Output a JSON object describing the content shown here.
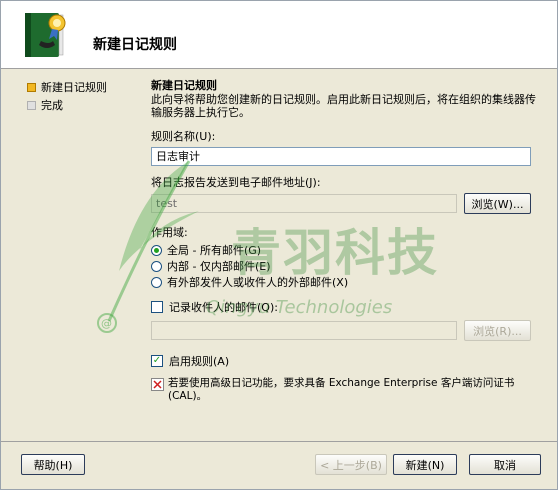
{
  "header": {
    "title": "新建日记规则"
  },
  "nav": {
    "items": [
      {
        "label": "新建日记规则"
      },
      {
        "label": "完成"
      }
    ]
  },
  "content": {
    "section_title": "新建日记规则",
    "description": "此向导将帮助您创建新的日记规则。启用此新日记规则后，将在组织的集线器传输服务器上执行它。",
    "rule_name_label": "规则名称(U):",
    "rule_name_value": "日志审计",
    "email_label": "将日志报告发送到电子邮件地址(J):",
    "email_value": "test",
    "browse_button": "浏览(W)...",
    "scope_label": "作用域:",
    "scope_options": [
      {
        "label": "全局 - 所有邮件(G)",
        "selected": true
      },
      {
        "label": "内部 - 仅内部邮件(E)",
        "selected": false
      },
      {
        "label": "有外部发件人或收件人的外部邮件(X)",
        "selected": false
      }
    ],
    "journal_recipient_label": "记录收件人的邮件(Q):",
    "journal_recipient_checked": false,
    "recipient_value": "",
    "browse_recipient_button": "浏览(R)...",
    "enable_rule_label": "启用规则(A)",
    "enable_rule_checked": true,
    "premium_note": "若要使用高级日记功能，要求具备 Exchange Enterprise 客户端访问证书(CAL)。"
  },
  "footer": {
    "help_button": "帮助(H)",
    "back_button": "< 上一步(B)",
    "new_button": "新建(N)",
    "cancel_button": "取消"
  },
  "watermark": {
    "cn_text": "青羽科技",
    "en_text": "Qingyu Technologies"
  },
  "colors": {
    "accent_bullet": "#f2b823",
    "watermark": "#3aa33a",
    "header_bg": "#ffffff",
    "dialog_bg": "#ece9d8"
  }
}
